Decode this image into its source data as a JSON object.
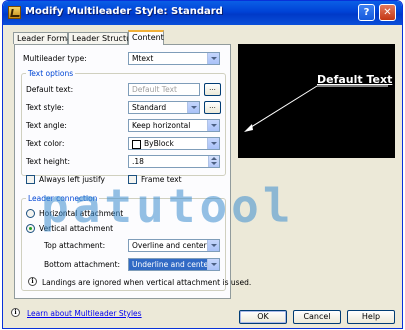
{
  "title": "Modify Multileader Style: Standard",
  "tabs": [
    {
      "label": "Leader Format"
    },
    {
      "label": "Leader Structure"
    },
    {
      "label": "Content"
    }
  ],
  "content": {
    "multileader_type": {
      "label": "Multileader type:",
      "value": "Mtext"
    },
    "text_options": {
      "heading": "Text options",
      "default_text": {
        "label": "Default text:",
        "value": "Default Text",
        "button": "..."
      },
      "text_style": {
        "label": "Text style:",
        "value": "Standard",
        "button": "..."
      },
      "text_angle": {
        "label": "Text angle:",
        "value": "Keep horizontal"
      },
      "text_color": {
        "label": "Text color:",
        "value": "ByBlock"
      },
      "text_height": {
        "label": "Text height:",
        "value": ".18"
      },
      "always_left_justify": {
        "label": "Always left justify",
        "checked": false
      },
      "frame_text": {
        "label": "Frame text",
        "checked": false
      }
    },
    "leader_connection": {
      "heading": "Leader connection",
      "horizontal": {
        "label": "Horizontal attachment",
        "selected": false
      },
      "vertical": {
        "label": "Vertical attachment",
        "selected": true
      },
      "top_attachment": {
        "label": "Top attachment:",
        "value": "Overline and center"
      },
      "bottom_attachment": {
        "label": "Bottom attachment:",
        "value": "Underline and center"
      },
      "note": "Landings are ignored when vertical attachment is used."
    }
  },
  "preview": {
    "text": "Default Text"
  },
  "footer": {
    "link": "Learn about Multileader Styles",
    "ok": "OK",
    "cancel": "Cancel",
    "help": "Help"
  },
  "watermark": "patutool",
  "colors": {
    "title_bar": "#0042d6",
    "group_heading": "#0046d5",
    "preview_bg": "#000000",
    "highlight": "#316ac5"
  }
}
